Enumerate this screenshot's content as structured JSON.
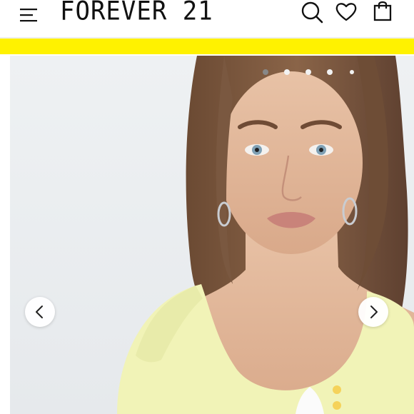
{
  "header": {
    "brand": "FOREVER 21",
    "icons": {
      "menu": "hamburger-menu-icon",
      "search": "search-icon",
      "wishlist": "heart-icon",
      "bag": "shopping-bag-icon"
    }
  },
  "banner": {
    "color": "#fff200"
  },
  "gallery": {
    "image": "model-wearing-yellow-short-sleeve-top",
    "slide_count": 5,
    "active_slide": 1,
    "prev_icon": "chevron-left-icon",
    "next_icon": "chevron-right-icon"
  },
  "colors": {
    "top": "#f1f3b7",
    "background": "#eceff1",
    "banner": "#fff200"
  }
}
